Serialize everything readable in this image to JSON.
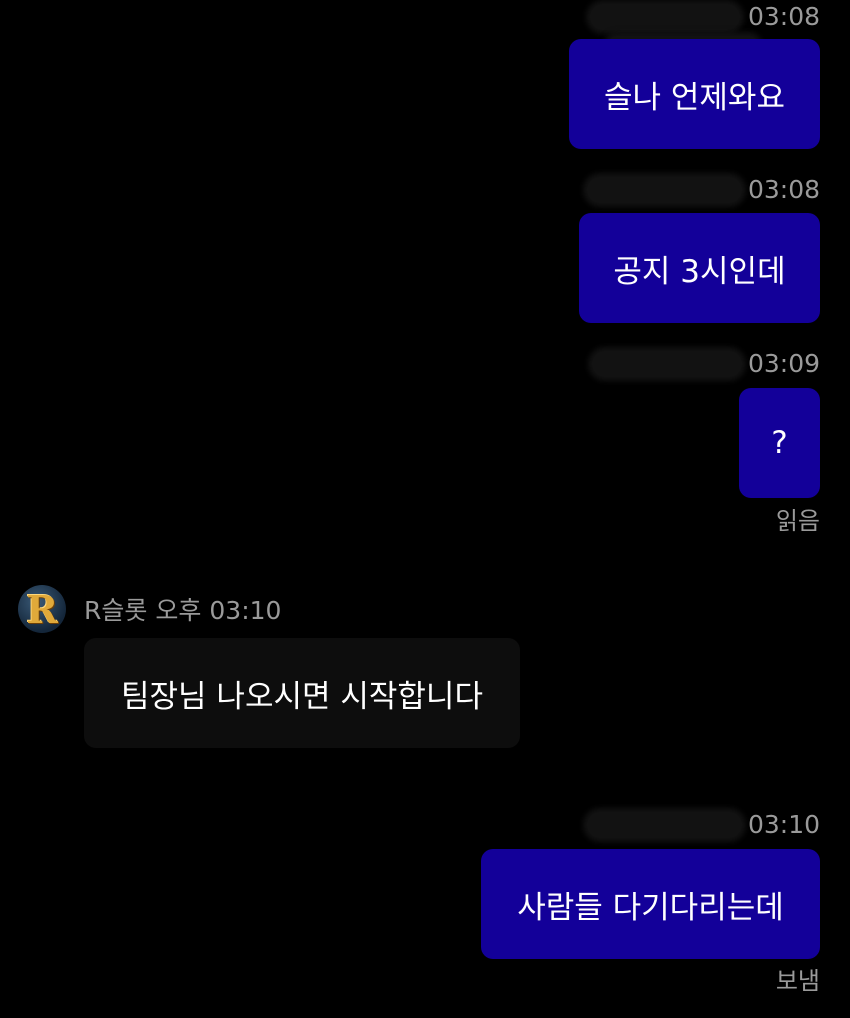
{
  "messages": [
    {
      "time": "03:08",
      "text": "슬나 언제와요"
    },
    {
      "time": "03:08",
      "text": "공지 3시인데"
    },
    {
      "time": "03:09",
      "text": "?",
      "status": "읽음"
    },
    {
      "sender": "R슬롯",
      "ampm": "오후",
      "time": "03:10",
      "text": "팀장님 나오시면 시작합니다",
      "avatar_letter": "R"
    },
    {
      "time": "03:10",
      "text": "사람들 다기다리는데",
      "status": "보냄"
    }
  ],
  "colors": {
    "background": "#000000",
    "outgoing_bubble": "#130099",
    "incoming_bubble": "#0d0d0d",
    "meta_text": "#9a9a9a",
    "message_text": "#ffffff"
  },
  "icons": {
    "avatar": "gold-letter-r-avatar-icon"
  }
}
